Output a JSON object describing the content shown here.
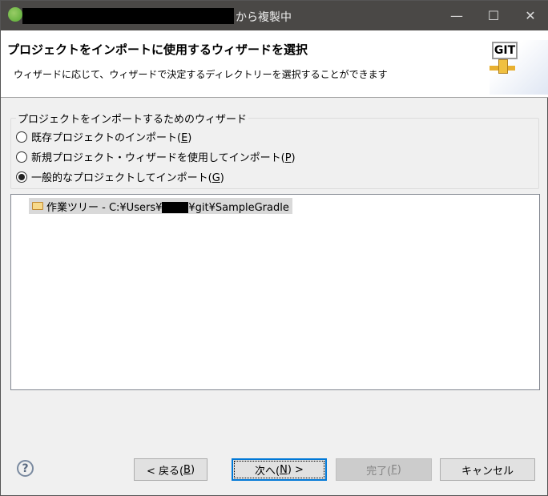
{
  "window": {
    "title": "から複製中",
    "minimize": "—",
    "maximize": "☐",
    "close": "✕"
  },
  "header": {
    "title": "プロジェクトをインポートに使用するウィザードを選択",
    "description": "ウィザードに応じて、ウィザードで決定するディレクトリーを選択することができます",
    "logo_text": "GIT"
  },
  "group": {
    "legend": "プロジェクトをインポートするためのウィザード",
    "options": [
      {
        "label": "既存プロジェクトのインポート(",
        "mnemonic": "E",
        "selected": false
      },
      {
        "label": "新規プロジェクト・ウィザードを使用してインポート(",
        "mnemonic": "P",
        "selected": false
      },
      {
        "label": "一般的なプロジェクトしてインポート(",
        "mnemonic": "G",
        "selected": true
      }
    ]
  },
  "tree": {
    "item_prefix": "作業ツリー - C:¥Users¥",
    "item_suffix": "¥git¥SampleGradle"
  },
  "buttons": {
    "help": "?",
    "back": "< 戻る(",
    "back_m": "B",
    "next": "次へ(",
    "next_m": "N",
    "next_suffix": ") >",
    "finish": "完了(",
    "finish_m": "F",
    "cancel": "キャンセル",
    "close_paren": ")"
  }
}
